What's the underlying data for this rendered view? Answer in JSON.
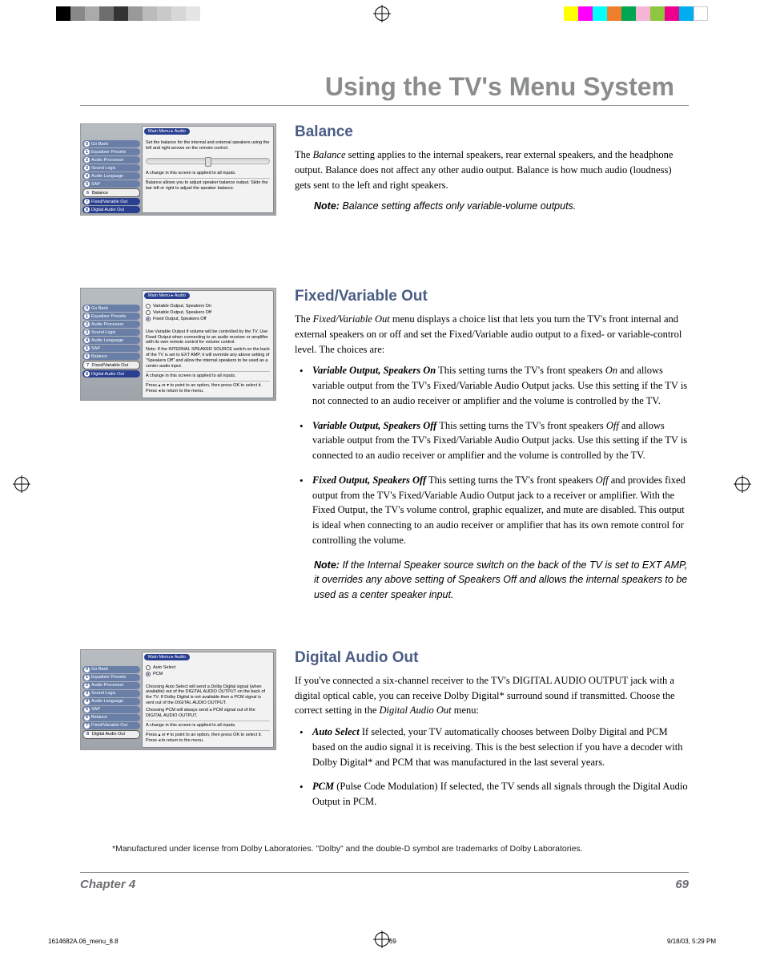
{
  "header": {
    "title": "Using the TV's Menu System"
  },
  "color_bars_left": [
    "#000000",
    "#888888",
    "#aaaaaa",
    "#6e6e6e",
    "#333333",
    "#999999",
    "#bbbbbb",
    "#c9c9c9",
    "#d7d7d7",
    "#e5e5e5"
  ],
  "color_bars_right": [
    "#ffff00",
    "#ff00ff",
    "#00ffff",
    "#ef7f2c",
    "#00a651",
    "#f7b5d6",
    "#8dc63f",
    "#ec008c",
    "#00aeef",
    "#ffffff"
  ],
  "sections": {
    "balance": {
      "heading": "Balance",
      "para": "The Balance setting applies to the internal speakers, rear external speakers, and the headphone output. Balance does not affect any other audio output. Balance is how much audio (loudness) gets sent to the left and right speakers.",
      "para_lead_ital": "Balance",
      "note_label": "Note:",
      "note": "Balance setting affects only variable-volume outputs."
    },
    "fixedvar": {
      "heading": "Fixed/Variable Out",
      "para": "The Fixed/Variable Out menu displays a choice list that lets you turn the TV's front internal and external speakers on or off and set the Fixed/Variable audio output to a fixed- or variable-control level.  The choices are:",
      "para_lead_ital": "Fixed/Variable Out",
      "bullets": [
        {
          "lead": "Variable Output, Speakers On",
          "ital": "On",
          "text": "   This setting turns the TV's front speakers On and allows variable output from the TV's Fixed/Variable Audio Output jacks. Use this setting if the TV is not connected to an audio receiver or amplifier and the volume is controlled by the TV."
        },
        {
          "lead": "Variable Output, Speakers Off",
          "ital": "Off",
          "text": "   This setting turns the TV's front speakers Off and allows variable output from the TV's Fixed/Variable Audio Output jacks. Use this setting if the TV is connected to an audio receiver or amplifier and the volume is controlled by the TV."
        },
        {
          "lead": "Fixed Output, Speakers Off",
          "ital": "Off",
          "text": "   This setting turns the TV's front speakers  Off and provides fixed output from the TV's Fixed/Variable Audio Output jack to a receiver or amplifier. With the Fixed Output, the TV's volume control, graphic equalizer, and mute are disabled.  This output is ideal when connecting to an audio receiver or amplifier that has its own remote control for controlling the volume."
        }
      ],
      "note_label": "Note:",
      "note": "If the Internal Speaker source switch on the back of the TV is set to EXT AMP, it overrides any above setting of Speakers Off and allows the internal speakers to be used as a center speaker input."
    },
    "digital": {
      "heading": "Digital Audio Out",
      "para": "If you've connected a six-channel receiver to the TV's DIGITAL AUDIO OUTPUT jack with a digital optical cable, you can receive Dolby Digital* surround sound if transmitted. Choose the correct setting in the Digital Audio Out menu:",
      "para_lead_ital": "Digital Audio Out",
      "bullets": [
        {
          "lead": "Auto Select",
          "text": "   If selected, your TV automatically chooses between Dolby Digital and PCM based on the audio signal it is receiving. This is the best selection if you have a decoder with Dolby Digital* and PCM that was manufactured in the last several years."
        },
        {
          "lead": "PCM",
          "paren": " (Pulse Code Modulation)",
          "text": "   If selected, the TV sends all signals through the Digital Audio Output in PCM."
        }
      ]
    }
  },
  "menu": {
    "breadcrumb": "Main Menu ▸ Audio",
    "items": [
      {
        "num": "0",
        "label": "Go Back"
      },
      {
        "num": "1",
        "label": "Equalizer Presets"
      },
      {
        "num": "2",
        "label": "Audio Processor"
      },
      {
        "num": "3",
        "label": "Sound Logic"
      },
      {
        "num": "4",
        "label": "Audio Language"
      },
      {
        "num": "5",
        "label": "SAP"
      },
      {
        "num": "6",
        "label": "Balance"
      },
      {
        "num": "7",
        "label": "Fixed/Variable Out"
      },
      {
        "num": "8",
        "label": "Digital Audio Out"
      }
    ],
    "balance_panel": {
      "top": "Set the balance for the internal and external speakers using the left and right arrows on the remote control.",
      "mid": "A change in this screen is applied to all inputs.",
      "bot": "Balance allows you to adjust speaker balance output. Slide the bar left or right to adjust the speaker balance."
    },
    "fixedvar_panel": {
      "options": [
        "Variable Output, Speakers On",
        "Variable Output, Speakers Off",
        "Fixed Output, Speakers Off"
      ],
      "selected": 2,
      "help1": "Use Variable Output if volume will be controlled by the TV. Use Fixed Output when connecting to an audio receiver or amplifier with its own remote control for volume control.",
      "help2": "Note: If the INTERNAL SPEAKER SOURCE switch on the back of the TV is set to EXT AMP, it will override any above setting of \"Speakers Off\" and allow the internal speakers to be used as a center audio input.",
      "mid": "A change in this screen is applied to all inputs.",
      "bot": "Press ▴ or ▾ to point to an option, then press OK to select it. Press ◂ to return to the menu."
    },
    "digital_panel": {
      "options": [
        "Auto Select",
        "PCM"
      ],
      "selected": 1,
      "help1": "Choosing Auto Select will send a Dolby Digital signal (when available) out of the DIGITAL AUDIO OUTPUT on the back of the TV. If Dolby Digital is not available then a PCM signal is sent out of the DIGITAL AUDIO OUTPUT.",
      "help2": "Choosing PCM will always send a PCM signal out of the DIGITAL AUDIO OUTPUT.",
      "mid": "A change in this screen is applied to all inputs.",
      "bot": "Press ▴ or ▾ to point to an option, then press OK to select it. Press ◂ to return to the menu."
    }
  },
  "footnote": "*Manufactured under license from Dolby Laboratories. \"Dolby\" and the double-D symbol are trademarks of Dolby Laboratories.",
  "footer": {
    "chapter": "Chapter 4",
    "page": "69"
  },
  "meta": {
    "file": "1614682A.06_menu_8.8",
    "sheet": "69",
    "ts": "9/18/03, 5:29 PM"
  }
}
